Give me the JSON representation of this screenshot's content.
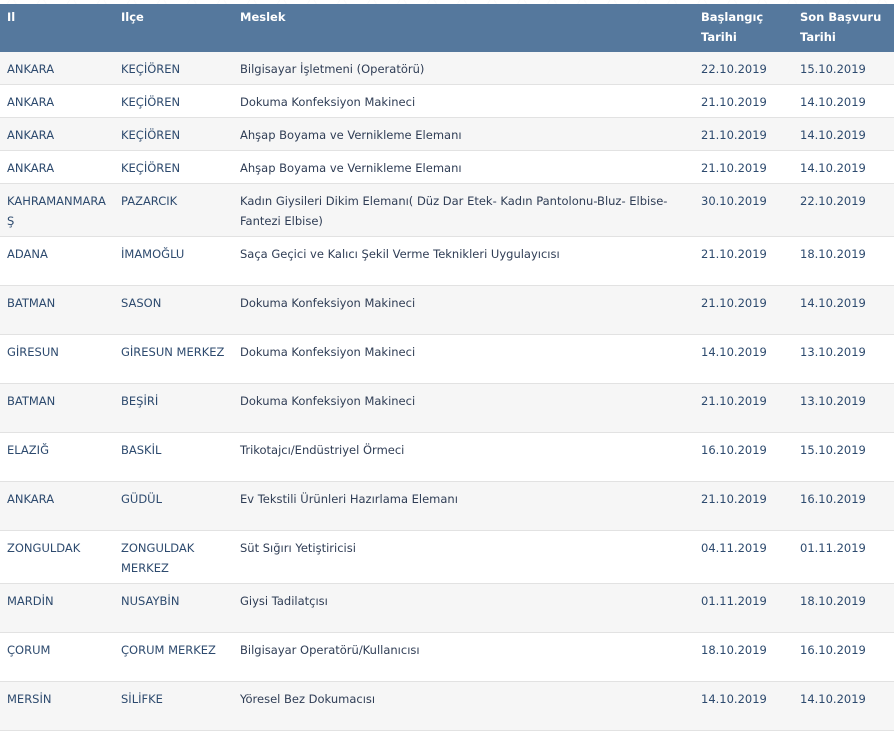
{
  "headers": {
    "province": "Il",
    "district": "Ilçe",
    "occupation": "Meslek",
    "start_date_line1": "Başlangıç",
    "start_date_line2": "Tarihi",
    "deadline_line1": "Son Başvuru",
    "deadline_line2": "Tarihi"
  },
  "rows": [
    {
      "province": "ANKARA",
      "district": "KEÇİÖREN",
      "occupation": "Bilgisayar İşletmeni (Operatörü)",
      "start": "22.10.2019",
      "deadline": "15.10.2019"
    },
    {
      "province": "ANKARA",
      "district": "KEÇİÖREN",
      "occupation": "Dokuma Konfeksiyon Makineci",
      "start": "21.10.2019",
      "deadline": "14.10.2019"
    },
    {
      "province": "ANKARA",
      "district": "KEÇİÖREN",
      "occupation": "Ahşap Boyama ve Vernikleme Elemanı",
      "start": "21.10.2019",
      "deadline": "14.10.2019"
    },
    {
      "province": "ANKARA",
      "district": "KEÇİÖREN",
      "occupation": "Ahşap Boyama ve Vernikleme Elemanı",
      "start": "21.10.2019",
      "deadline": "14.10.2019"
    },
    {
      "province": "KAHRAMANMARAŞ",
      "district": "PAZARCIK",
      "occupation": "Kadın Giysileri Dikim Elemanı( Düz Dar Etek- Kadın Pantolonu-Bluz- Elbise-Fantezi Elbise)",
      "start": "30.10.2019",
      "deadline": "22.10.2019"
    },
    {
      "province": "ADANA",
      "district": "İMAMOĞLU",
      "occupation": "Saça Geçici ve Kalıcı Şekil Verme Teknikleri Uygulayıcısı",
      "start": "21.10.2019",
      "deadline": "18.10.2019"
    },
    {
      "province": "BATMAN",
      "district": "SASON",
      "occupation": "Dokuma Konfeksiyon Makineci",
      "start": "21.10.2019",
      "deadline": "14.10.2019"
    },
    {
      "province": "GİRESUN",
      "district": "GİRESUN MERKEZ",
      "occupation": "Dokuma Konfeksiyon Makineci",
      "start": "14.10.2019",
      "deadline": "13.10.2019"
    },
    {
      "province": "BATMAN",
      "district": "BEŞİRİ",
      "occupation": "Dokuma Konfeksiyon Makineci",
      "start": "21.10.2019",
      "deadline": "13.10.2019"
    },
    {
      "province": "ELAZIĞ",
      "district": "BASKİL",
      "occupation": "Trikotajcı/Endüstriyel Örmeci",
      "start": "16.10.2019",
      "deadline": "15.10.2019"
    },
    {
      "province": "ANKARA",
      "district": "GÜDÜL",
      "occupation": "Ev Tekstili Ürünleri Hazırlama Elemanı",
      "start": "21.10.2019",
      "deadline": "16.10.2019"
    },
    {
      "province": "ZONGULDAK",
      "district": "ZONGULDAK MERKEZ",
      "occupation": "Süt Sığırı Yetiştiricisi",
      "start": "04.11.2019",
      "deadline": "01.11.2019"
    },
    {
      "province": "MARDİN",
      "district": "NUSAYBİN",
      "occupation": "Giysi Tadilatçısı",
      "start": "01.11.2019",
      "deadline": "18.10.2019"
    },
    {
      "province": "ÇORUM",
      "district": "ÇORUM MERKEZ",
      "occupation": "Bilgisayar Operatörü/Kullanıcısı",
      "start": "18.10.2019",
      "deadline": "16.10.2019"
    },
    {
      "province": "MERSİN",
      "district": "SİLİFKE",
      "occupation": "Yöresel Bez Dokumacısı",
      "start": "14.10.2019",
      "deadline": "14.10.2019"
    }
  ]
}
